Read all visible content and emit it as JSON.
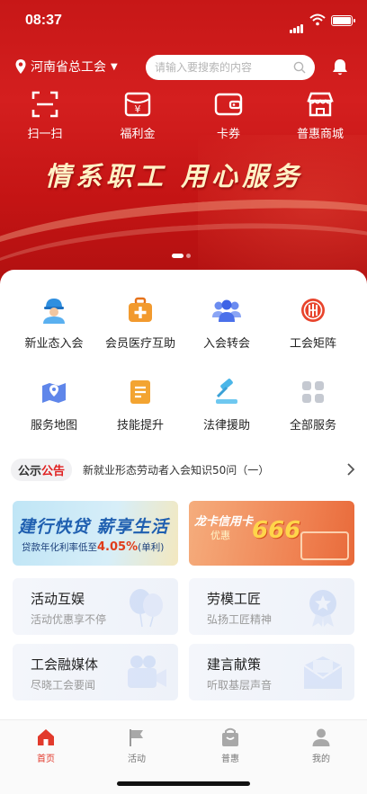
{
  "status": {
    "time": "08:37"
  },
  "header": {
    "location": "河南省总工会",
    "search_placeholder": "请输入要搜索的内容"
  },
  "quick_actions": [
    {
      "label": "扫一扫",
      "icon": "scan-icon"
    },
    {
      "label": "福利金",
      "icon": "welfare-icon"
    },
    {
      "label": "卡券",
      "icon": "wallet-icon"
    },
    {
      "label": "普惠商城",
      "icon": "shop-icon"
    }
  ],
  "hero": {
    "slogan": "情系职工  用心服务",
    "slide_count": 2,
    "active_slide": 1
  },
  "services": [
    {
      "label": "新业态入会",
      "icon": "worker-icon"
    },
    {
      "label": "会员医疗互助",
      "icon": "medical-kit-icon"
    },
    {
      "label": "入会转会",
      "icon": "group-icon"
    },
    {
      "label": "工会矩阵",
      "icon": "union-emblem-icon"
    },
    {
      "label": "服务地图",
      "icon": "map-icon"
    },
    {
      "label": "技能提升",
      "icon": "skill-icon"
    },
    {
      "label": "法律援助",
      "icon": "gavel-icon"
    },
    {
      "label": "全部服务",
      "icon": "grid-icon"
    }
  ],
  "notice": {
    "tag_prefix": "公示",
    "tag_suffix": "公告",
    "text": "新就业形态劳动者入会知识50问（一）"
  },
  "banners": {
    "ccb": {
      "title": "建行快贷 薪享生活",
      "sub_prefix": "贷款年化利率低至",
      "rate": "4.05%",
      "sub_suffix": "(单利)"
    },
    "longka": {
      "title": "龙卡信用卡",
      "sub": "优惠",
      "big": "666"
    }
  },
  "tiles": [
    {
      "title": "活动互娱",
      "sub": "活动优惠享不停"
    },
    {
      "title": "劳模工匠",
      "sub": "弘扬工匠精神"
    },
    {
      "title": "工会融媒体",
      "sub": "尽晓工会要闻"
    },
    {
      "title": "建言献策",
      "sub": "听取基层声音"
    }
  ],
  "tabbar": [
    {
      "label": "首页",
      "icon": "home-icon",
      "active": true
    },
    {
      "label": "活动",
      "icon": "flag-icon",
      "active": false
    },
    {
      "label": "普惠",
      "icon": "bag-icon",
      "active": false
    },
    {
      "label": "我的",
      "icon": "user-icon",
      "active": false
    }
  ],
  "colors": {
    "brand_red": "#d41f1f",
    "tab_active": "#e23a2c"
  }
}
